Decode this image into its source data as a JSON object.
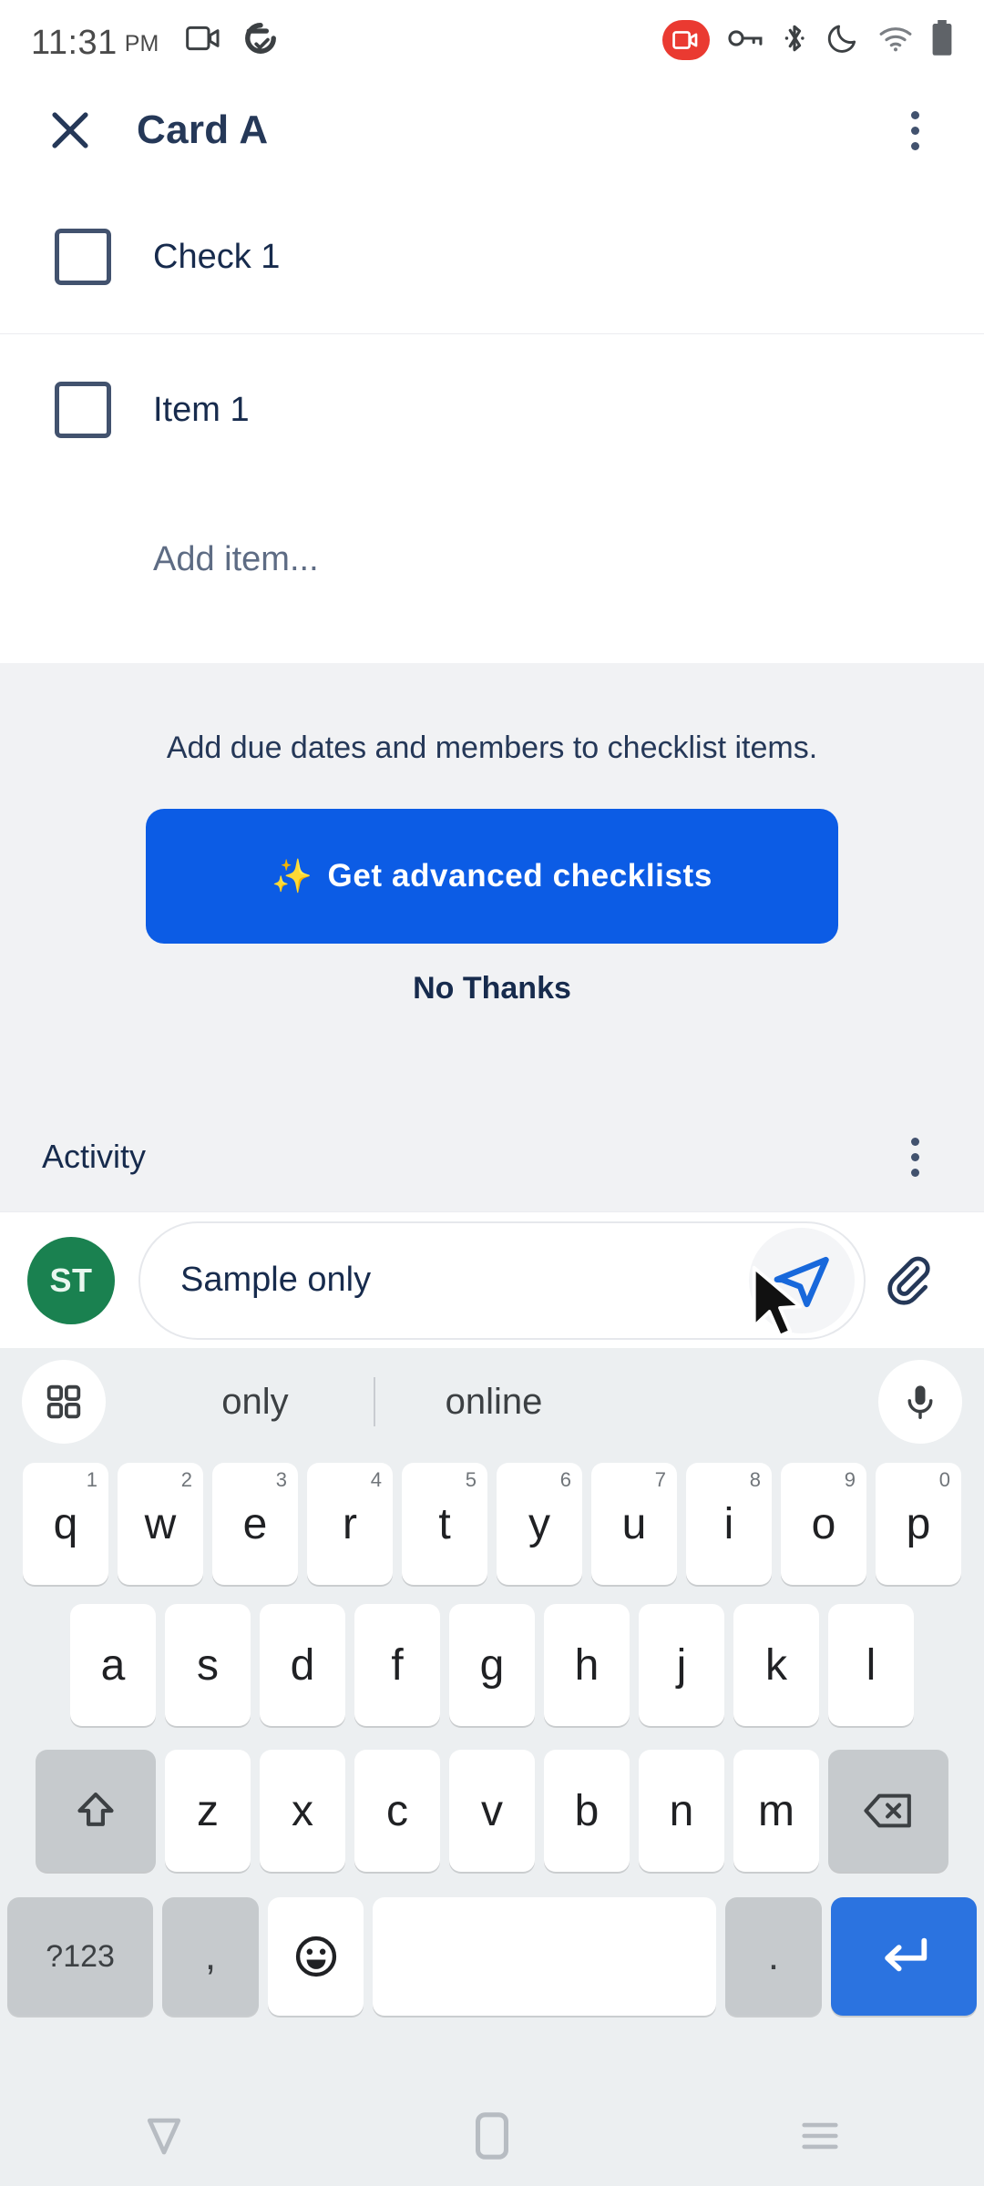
{
  "status_bar": {
    "time": "11:31",
    "meridiem": "PM",
    "left_icons": [
      "screen-record-icon",
      "data-saver-icon"
    ],
    "right_icons": [
      "recording-badge-icon",
      "vpn-key-icon",
      "bluetooth-icon",
      "do-not-disturb-moon-icon",
      "wifi-icon",
      "battery-icon"
    ],
    "recording_badge_color": "#ea3a31"
  },
  "app_bar": {
    "close_label": "Close",
    "title": "Card A",
    "overflow_label": "More options"
  },
  "checklist": {
    "items": [
      {
        "label": "Check 1",
        "checked": false
      },
      {
        "label": "Item 1",
        "checked": false
      }
    ],
    "add_item_placeholder": "Add item..."
  },
  "promo": {
    "message": "Add due dates and members to checklist items.",
    "cta_sparkle": "✨",
    "cta_label": "Get advanced checklists",
    "dismiss_label": "No Thanks",
    "cta_color": "#0c5ce5",
    "background": "#f1f2f4"
  },
  "activity": {
    "title": "Activity",
    "overflow_label": "Activity options"
  },
  "comment_bar": {
    "avatar_initials": "ST",
    "avatar_color": "#1a8150",
    "input_value": "Sample only",
    "send_label": "Send",
    "attach_label": "Attach file"
  },
  "keyboard": {
    "suggestions": [
      "only",
      "online"
    ],
    "grid_icon": "apps-grid-icon",
    "mic_icon": "microphone-icon",
    "row1": [
      {
        "key": "q",
        "num": "1"
      },
      {
        "key": "w",
        "num": "2"
      },
      {
        "key": "e",
        "num": "3"
      },
      {
        "key": "r",
        "num": "4"
      },
      {
        "key": "t",
        "num": "5"
      },
      {
        "key": "y",
        "num": "6"
      },
      {
        "key": "u",
        "num": "7"
      },
      {
        "key": "i",
        "num": "8"
      },
      {
        "key": "o",
        "num": "9"
      },
      {
        "key": "p",
        "num": "0"
      }
    ],
    "row2": [
      "a",
      "s",
      "d",
      "f",
      "g",
      "h",
      "j",
      "k",
      "l"
    ],
    "row3": [
      "z",
      "x",
      "c",
      "v",
      "b",
      "n",
      "m"
    ],
    "shift_label": "shift-icon",
    "backspace_label": "backspace-icon",
    "row4": {
      "symbols_label": "?123",
      "comma_label": ",",
      "emoji_label": "emoji-icon",
      "space_label": "",
      "period_label": ".",
      "enter_label": "enter-icon",
      "enter_color": "#2b73e0"
    }
  },
  "nav_bar": {
    "back_label": "Back",
    "home_label": "Home",
    "recents_label": "Recent apps"
  }
}
